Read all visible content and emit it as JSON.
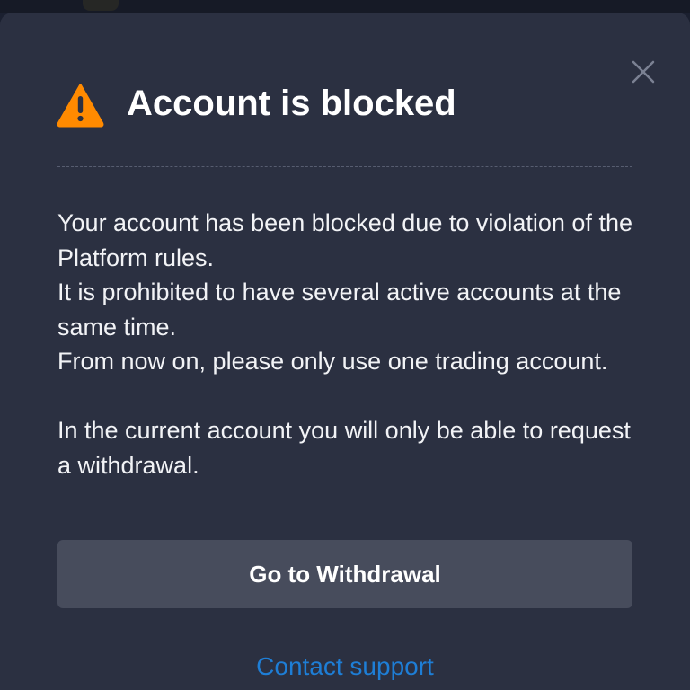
{
  "dialog": {
    "title": "Account is blocked",
    "icons": {
      "warning": "warning-triangle-icon",
      "close": "close-icon"
    },
    "message": {
      "paragraph_1": "Your account has been blocked due to violation of the Platform rules.",
      "paragraph_2": "It is prohibited to have several active accounts at the same time.",
      "paragraph_3": "From now on, please only use one trading account.",
      "paragraph_4": "In the current account you will only be able to request a withdrawal."
    },
    "primary_button_label": "Go to Withdrawal",
    "support_link_label": "Contact support"
  },
  "colors": {
    "warning": "#ff8a00",
    "link": "#1e7ed6",
    "modal_background": "#2b3041",
    "button_background": "#474c5c"
  }
}
